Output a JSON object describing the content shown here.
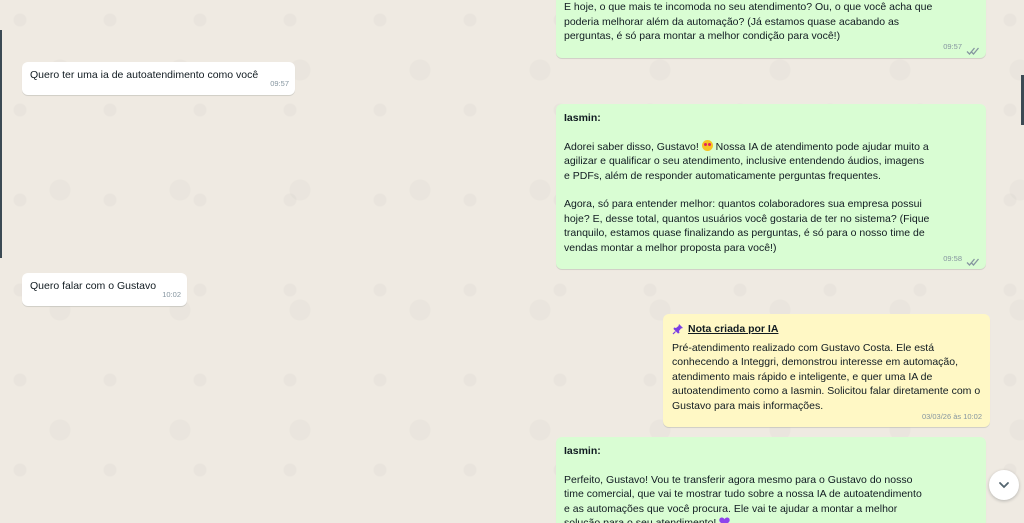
{
  "messages": [
    {
      "lines": [
        "E hoje, o que mais te incomoda no seu atendimento? Ou, o que você acha que",
        "poderia melhorar além da automação? (Já estamos quase acabando as",
        "perguntas, é só para montar a melhor condição para você!)"
      ],
      "time": "09:57"
    },
    {
      "text": "Quero ter uma ia de autoatendimento como você",
      "time": "09:57"
    },
    {
      "author": "Iasmin:",
      "para1_a": "Adorei saber disso, Gustavo! ",
      "para1_emoji": "heart-eyes-emoji",
      "para1_b": " Nossa IA de atendimento pode ajudar muito a\nagilizar e qualificar o seu atendimento, inclusive entendendo áudios, imagens\ne PDFs, além de responder automaticamente perguntas frequentes.",
      "para2": "Agora, só para entender melhor: quantos colaboradores sua empresa possui\nhoje? E, desse total, quantos usuários você gostaria de ter no sistema? (Fique\ntranquilo, estamos quase finalizando as perguntas, é só para o nosso time de\nvendas montar a melhor proposta para você!)",
      "time": "09:58"
    },
    {
      "text": "Quero falar com o Gustavo",
      "time": "10:02"
    },
    {
      "title": "Nota criada por IA",
      "body": "Pré-atendimento realizado com Gustavo Costa. Ele está\nconhecendo a Integgri, demonstrou interesse em automação,\natendimento mais rápido e inteligente, e quer uma IA de\nautoatendimento como a Iasmin. Solicitou falar diretamente com o\nGustavo para mais informações.",
      "time": "03/03/26 às 10:02"
    },
    {
      "author": "Iasmin:",
      "body": "Perfeito, Gustavo! Vou te transferir agora mesmo para o Gustavo do nosso\ntime comercial, que vai te mostrar tudo sobre a nossa IA de autoatendimento\ne as automações que você procura. Ele vai te ajudar a montar a melhor\nsolução para o seu atendimento! "
    }
  ],
  "icons": {
    "read_ticks": "double-check-icon",
    "pin": "pushpin-icon",
    "heart": "purple-heart-emoji",
    "scroll": "chevron-down-icon"
  },
  "colors": {
    "chat_bg": "#efeae2",
    "incoming": "#ffffff",
    "outgoing": "#d9fdd3",
    "note": "#fff8c5",
    "ticks": "#8696a0"
  }
}
